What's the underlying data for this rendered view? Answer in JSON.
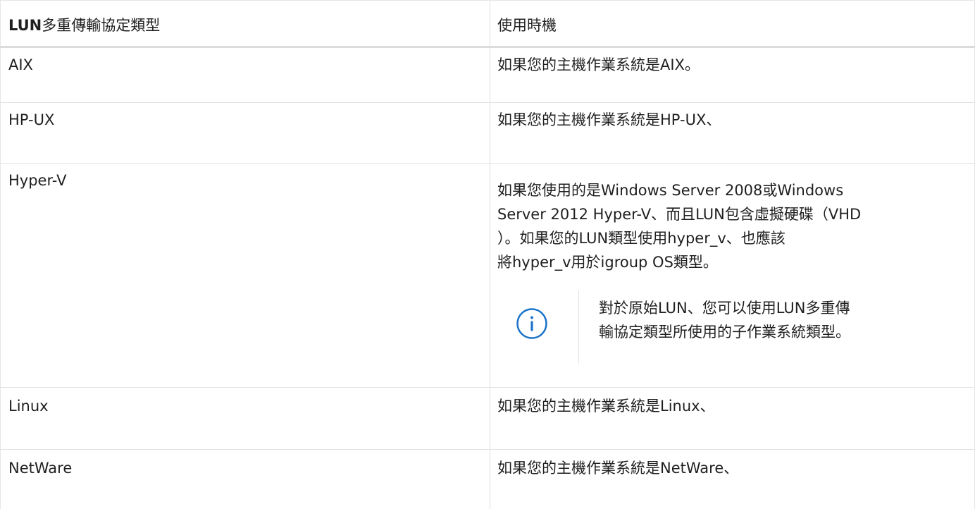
{
  "table": {
    "header": {
      "col1_bold": "LUN",
      "col1_rest": "多重傳輸協定類型",
      "col2": "使用時機"
    },
    "rows": [
      {
        "type": "AIX",
        "when": "如果您的主機作業系統是AIX。"
      },
      {
        "type": "HP-UX",
        "when": "如果您的主機作業系統是HP-UX、"
      },
      {
        "type": "Hyper-V",
        "when_lines": [
          "如果您使用的是Windows Server 2008或Windows",
          "Server 2012 Hyper-V、而且LUN包含虛擬硬碟（VHD",
          "）。如果您的LUN類型使用hyper_v、也應該",
          "將hyper_v用於igroup OS類型。"
        ],
        "note": {
          "icon": "info-icon",
          "lines": [
            "對於原始LUN、您可以使用LUN多重傳",
            "輸協定類型所使用的子作業系統類型。"
          ]
        }
      },
      {
        "type": "Linux",
        "when": "如果您的主機作業系統是Linux、"
      },
      {
        "type": "NetWare",
        "when": "如果您的主機作業系統是NetWare、"
      }
    ]
  },
  "colors": {
    "text": "#1f1f1f",
    "border": "#e2e2e2",
    "info_icon": "#1a73c8"
  }
}
